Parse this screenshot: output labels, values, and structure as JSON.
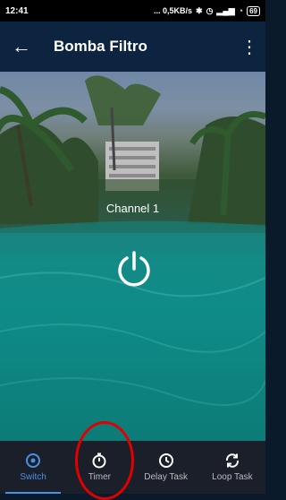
{
  "status_bar": {
    "time": "12:41",
    "network": "... 0,5KB/s",
    "battery": "69"
  },
  "appbar": {
    "title": "Bomba Filtro",
    "back_icon": "back-arrow-icon",
    "more_icon": "more-vert-icon"
  },
  "main": {
    "channel_label": "Channel 1",
    "power_icon": "power-icon"
  },
  "tabs": [
    {
      "label": "Switch",
      "icon": "switch-icon",
      "active": true
    },
    {
      "label": "Timer",
      "icon": "timer-icon",
      "active": false
    },
    {
      "label": "Delay Task",
      "icon": "clock-icon",
      "active": false
    },
    {
      "label": "Loop Task",
      "icon": "loop-icon",
      "active": false
    }
  ],
  "colors": {
    "accent": "#4a90e2",
    "appbar": "#0d2440",
    "tabbar": "#1b1f2a",
    "annotation": "#e00000"
  }
}
